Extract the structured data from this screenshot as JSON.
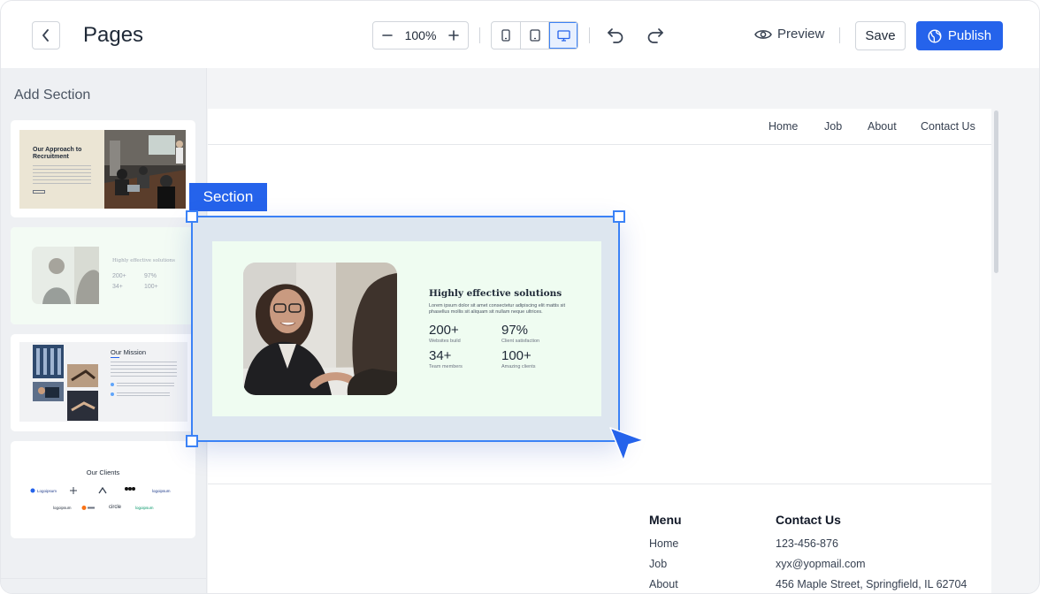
{
  "toolbar": {
    "title": "Pages",
    "zoom": "100%",
    "preview_label": "Preview",
    "save_label": "Save",
    "publish_label": "Publish",
    "accent_color": "#2563eb"
  },
  "sidebar": {
    "title": "Add Section",
    "thumbs": [
      {
        "heading": "Our Approach to Recruitment"
      },
      {
        "heading": "Highly effective solutions",
        "stats": [
          "200+",
          "97%",
          "34+",
          "100+"
        ]
      },
      {
        "heading": "Our Mission"
      },
      {
        "heading": "Our Clients",
        "logos_row1": [
          "Logoipsum",
          "",
          "",
          "",
          "logoipsum"
        ],
        "logos_row2": [
          "logoipsum",
          "",
          "circle",
          "logoipsum"
        ]
      }
    ]
  },
  "site": {
    "nav": [
      "Home",
      "Job",
      "About",
      "Contact Us"
    ],
    "footer": {
      "menu_title": "Menu",
      "menu_items": [
        "Home",
        "Job",
        "About"
      ],
      "contact_title": "Contact Us",
      "contact_items": [
        "123-456-876",
        "xyx@yopmail.com",
        "456 Maple Street, Springfield, IL 62704"
      ]
    }
  },
  "selection": {
    "tag": "Section",
    "heading": "Highly effective solutions",
    "description": "Lorem ipsum dolor sit amet consectetur adipiscing elit mattis sit phasellus mollis sit aliquam sit nullam neque ultrices.",
    "stats": [
      {
        "value": "200+",
        "label": "Websites build"
      },
      {
        "value": "97%",
        "label": "Client satisfaction"
      },
      {
        "value": "34+",
        "label": "Team members"
      },
      {
        "value": "100+",
        "label": "Amazing clients"
      }
    ]
  }
}
